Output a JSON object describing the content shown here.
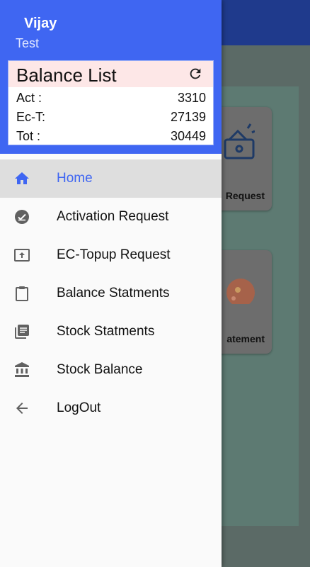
{
  "drawer": {
    "user_name": "Vijay",
    "user_subtitle": "Test",
    "balance": {
      "title": "Balance List",
      "refresh_icon": "refresh-icon",
      "rows": [
        {
          "label": "Act :",
          "value": "3310"
        },
        {
          "label": "Ec-T:",
          "value": "27139"
        },
        {
          "label": "Tot :",
          "value": "30449"
        }
      ]
    },
    "menu": [
      {
        "label": "Home",
        "icon": "home-icon",
        "active": true
      },
      {
        "label": "Activation Request",
        "icon": "check-circle-icon",
        "active": false
      },
      {
        "label": "EC-Topup Request",
        "icon": "upload-box-icon",
        "active": false
      },
      {
        "label": "Balance Statments",
        "icon": "clipboard-icon",
        "active": false
      },
      {
        "label": "Stock Statments",
        "icon": "library-books-icon",
        "active": false
      },
      {
        "label": "Stock Balance",
        "icon": "bank-icon",
        "active": false
      },
      {
        "label": "LogOut",
        "icon": "arrow-back-icon",
        "active": false
      }
    ]
  },
  "background": {
    "cards": [
      {
        "label": "Request"
      },
      {
        "label": "atement"
      }
    ]
  },
  "colors": {
    "accent": "#3f66f2",
    "header_bg": "#3f66f2",
    "balance_header_bg": "#fde7e7",
    "active_item_bg": "#dedede"
  }
}
